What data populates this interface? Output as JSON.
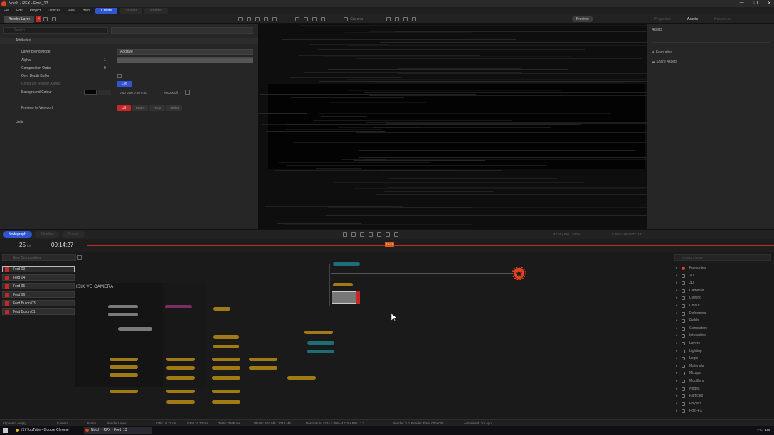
{
  "window": {
    "title": "Notch - RFX - Ford_13",
    "controls": [
      "—",
      "❐",
      "✕"
    ]
  },
  "menu": {
    "items": [
      "File",
      "Edit",
      "Project",
      "Devices",
      "View",
      "Help"
    ],
    "modes": [
      "Create",
      "Shader",
      "Render"
    ]
  },
  "toolbar": {
    "render_layer_label": "Render Layer",
    "camera_label": "Camera",
    "preview_label": "Preview",
    "right_tabs": [
      "Properties",
      "Assets",
      "Resources"
    ]
  },
  "attributes": {
    "search_placeholder": "Search",
    "section_title": "Attributes",
    "rows": [
      {
        "label": "Layer Blend Mode",
        "value": "Additive"
      },
      {
        "label": "Alpha",
        "value": "1"
      },
      {
        "label": "Composition Order",
        "value": "0"
      },
      {
        "label": "Own Depth Buffer",
        "value": ""
      },
      {
        "label": "Constrain Render Aspect",
        "value": "Left"
      },
      {
        "label": "Background Colour",
        "value": "0.00 0.00 0.00 0.00",
        "hex": "#000000ff"
      },
      {
        "label": "Preview In Viewport",
        "value": ""
      }
    ],
    "preview_options": [
      "Off",
      "RGBA",
      "RGB",
      "Alpha"
    ],
    "second_section": "Units"
  },
  "assets": {
    "header": "Assets",
    "items": [
      "Favourites",
      "Share Assets"
    ]
  },
  "nodegraph_bar": {
    "tabs": [
      "Nodegraph",
      "Timeline",
      "Curves"
    ],
    "stats_left": "4224 x 896 : 100%",
    "stats_right": "0.001  4.26   0.972  -171"
  },
  "timeline": {
    "fps": "25",
    "fps_unit": "fps",
    "timecode": "00:14:27",
    "playhead": "14:27"
  },
  "nodegraph": {
    "search_placeholder": "New Composition",
    "layers": [
      "Ford 03",
      "Ford 04",
      "Ford 05",
      "Ford 06",
      "Ford Buton 03",
      "Ford Buton 01"
    ],
    "camera_group_label": "ISIK VE CAMERA",
    "library_header": "Project Library",
    "library_items": [
      "Favourites",
      "2D",
      "3D",
      "Cameras",
      "Cloning",
      "Colour",
      "Deformers",
      "Fields",
      "Generators",
      "Interactive",
      "Layers",
      "Lighting",
      "Logic",
      "Materials",
      "Mixups",
      "Modifiers",
      "Nodes",
      "Particles",
      "Physics",
      "Post-FX"
    ]
  },
  "status": {
    "items": [
      "Clipboard empty",
      "Camera",
      "Param",
      "Render Layer",
      "CPU : 0.77 ms",
      "GPU : 0.77 ms",
      "Total: 25MB ms",
      "VRAM: 604 Mb / 7218 Mb",
      "Resolution: 4224 x 896 - 4224 x 896 : 1:1",
      "Render: 0.0, Render Time: 00m 00s",
      "Autosaved: 2m ago"
    ]
  },
  "taskbar": {
    "apps": [
      "(1) YouTube - Google Chrome",
      "Notch - RFX - Ford_13"
    ],
    "clock": "3:51 AM"
  },
  "colors": {
    "accent_blue": "#2f55d4",
    "accent_red": "#c62828",
    "node_gold": "#a07a14",
    "node_teal": "#1e6e78",
    "render_orange": "#e0421f"
  }
}
